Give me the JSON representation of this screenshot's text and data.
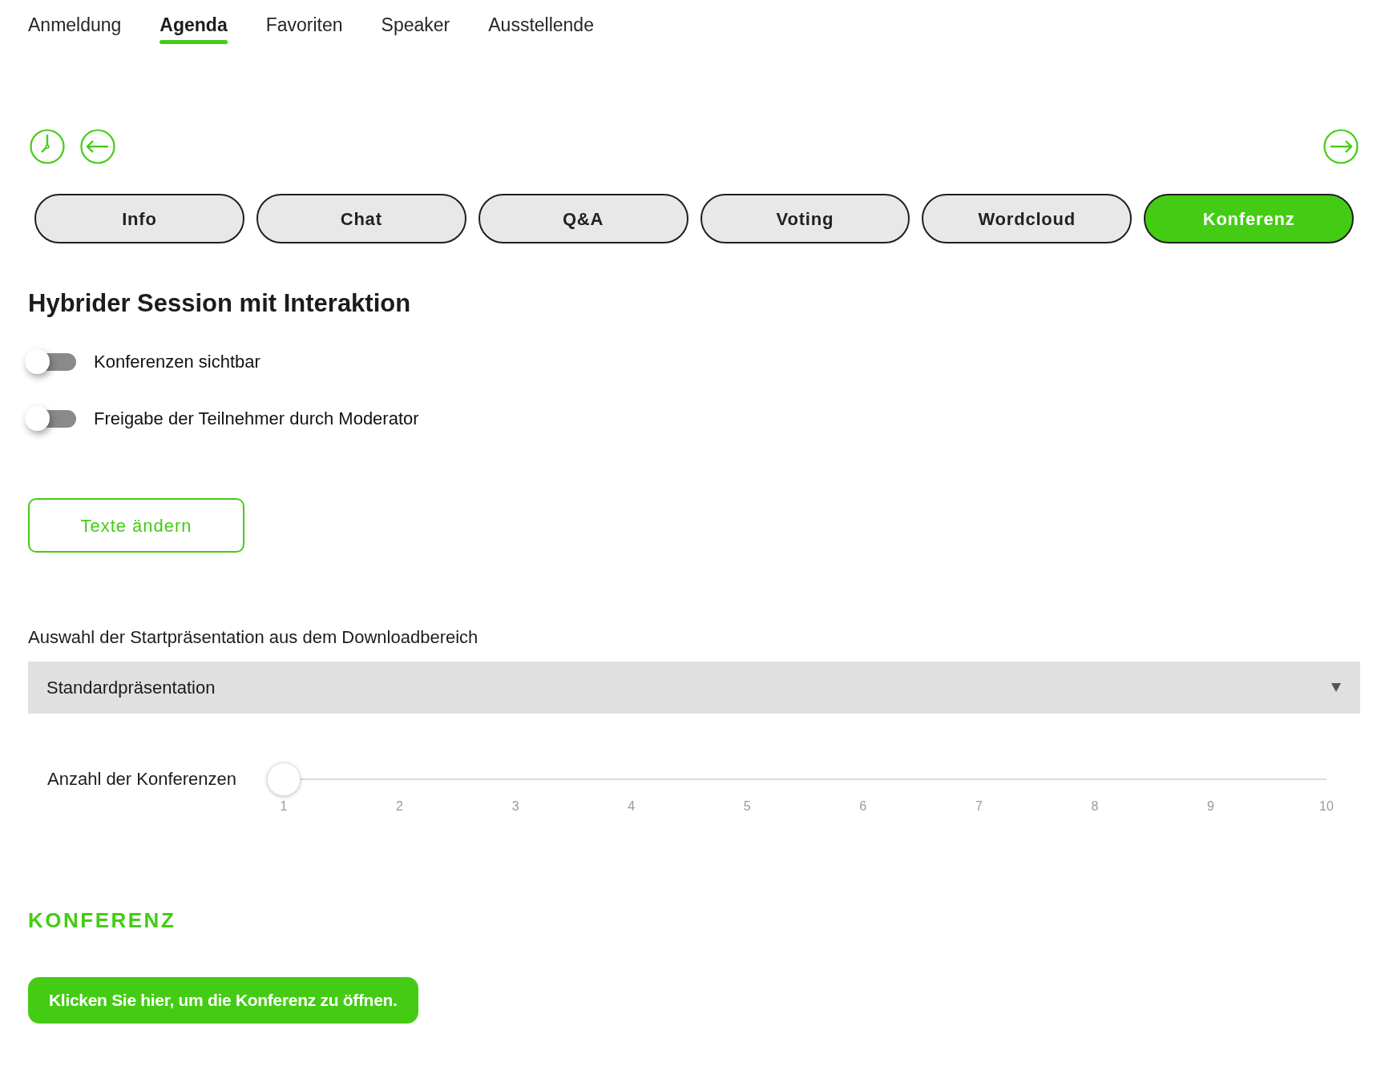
{
  "nav_tabs": [
    {
      "label": "Anmeldung",
      "selected": false
    },
    {
      "label": "Agenda",
      "selected": true
    },
    {
      "label": "Favoriten",
      "selected": false
    },
    {
      "label": "Speaker",
      "selected": false
    },
    {
      "label": "Ausstellende",
      "selected": false
    }
  ],
  "session_tabs": [
    {
      "label": "Info",
      "selected": false
    },
    {
      "label": "Chat",
      "selected": false
    },
    {
      "label": "Q&A",
      "selected": false
    },
    {
      "label": "Voting",
      "selected": false
    },
    {
      "label": "Wordcloud",
      "selected": false
    },
    {
      "label": "Konferenz",
      "selected": true
    }
  ],
  "session": {
    "title": "Hybrider Session mit Interaktion",
    "toggles": [
      {
        "label": "Konferenzen sichtbar",
        "on": false
      },
      {
        "label": "Freigabe der Teilnehmer durch Moderator",
        "on": false
      }
    ],
    "edit_button": {
      "label": "Texte ändern"
    },
    "start_presentation": {
      "label": "Auswahl der Startpräsentation aus dem Downloadbereich",
      "value": "Standardpräsentation"
    },
    "conference_count": {
      "label": "Anzahl der Konferenzen",
      "level": 0,
      "ticks": [
        "1",
        "2",
        "3",
        "4",
        "5",
        "6",
        "7",
        "8",
        "9",
        "10"
      ]
    }
  },
  "conference": {
    "heading": "KONFERENZ",
    "open_button": {
      "label": "Klicken Sie hier, um die Konferenz zu öffnen."
    }
  }
}
